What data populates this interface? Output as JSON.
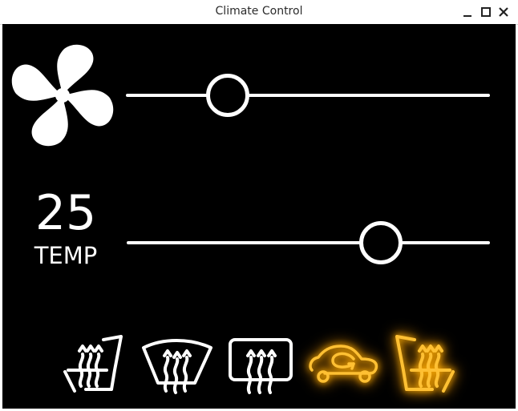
{
  "window": {
    "title": "Climate Control"
  },
  "fan": {
    "speed_fraction": 0.28
  },
  "temperature": {
    "value": "25",
    "label": "TEMP",
    "slider_fraction": 0.7
  },
  "controls": [
    {
      "name": "seat-heat-left-button",
      "icon": "seat-heat-icon",
      "active": false
    },
    {
      "name": "windshield-defrost-button",
      "icon": "front-defrost-icon",
      "active": false
    },
    {
      "name": "rear-defrost-button",
      "icon": "rear-defrost-icon",
      "active": false
    },
    {
      "name": "air-recirculation-button",
      "icon": "recirculation-icon",
      "active": true
    },
    {
      "name": "seat-heat-right-button",
      "icon": "seat-heat-icon",
      "active": true
    }
  ],
  "colors": {
    "background": "#000000",
    "foreground": "#ffffff",
    "active": "#ffc033"
  }
}
